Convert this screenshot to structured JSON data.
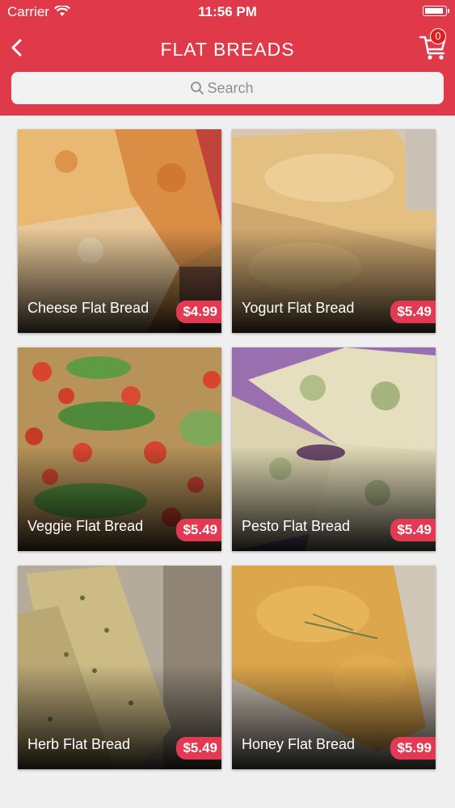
{
  "status_bar": {
    "carrier": "Carrier",
    "time": "11:56 PM"
  },
  "header": {
    "title": "FLAT BREADS",
    "cart_count": "0"
  },
  "search": {
    "placeholder": "Search"
  },
  "colors": {
    "brand": "#e03a4a",
    "price_tag": "#e23a52",
    "badge": "#e01e1e"
  },
  "items": [
    {
      "name": "Cheese Flat Bread",
      "price": "$4.99"
    },
    {
      "name": "Yogurt Flat Bread",
      "price": "$5.49"
    },
    {
      "name": "Veggie Flat Bread",
      "price": "$5.49"
    },
    {
      "name": "Pesto Flat Bread",
      "price": "$5.49"
    },
    {
      "name": "Herb Flat Bread",
      "price": "$5.49"
    },
    {
      "name": "Honey Flat Bread",
      "price": "$5.99"
    }
  ]
}
